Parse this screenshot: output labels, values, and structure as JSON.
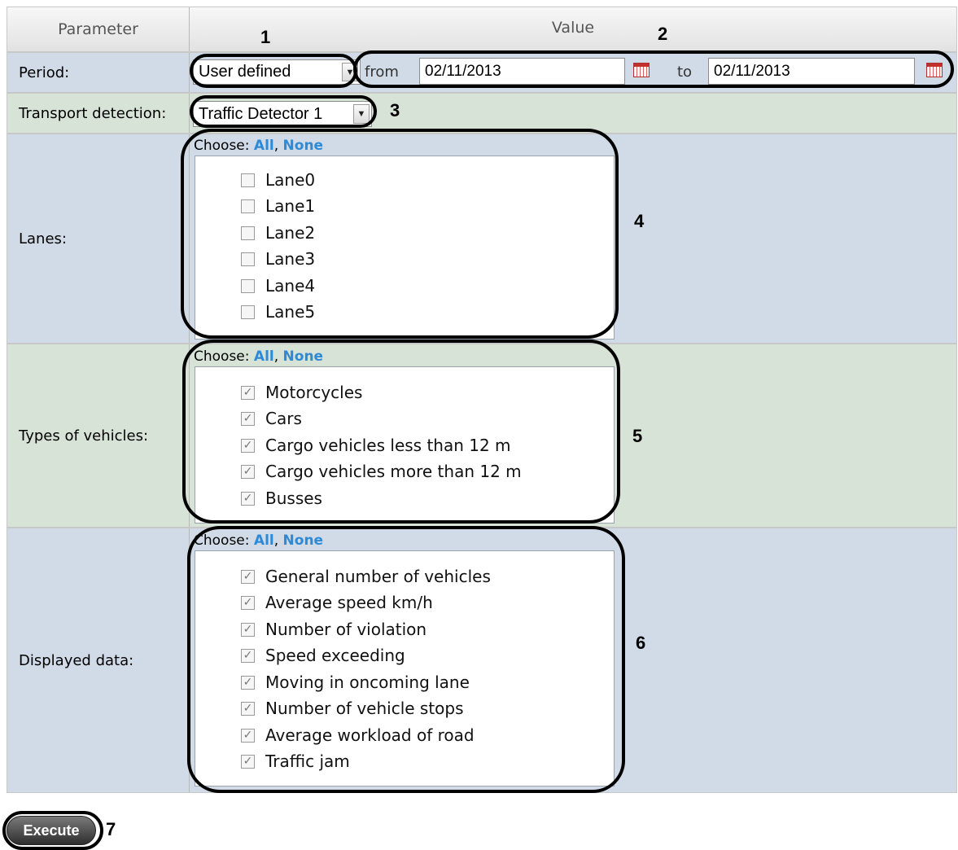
{
  "header": {
    "parameter": "Parameter",
    "value": "Value"
  },
  "period": {
    "label": "Period:",
    "selected": "User defined",
    "from_label": "from",
    "from_date": "02/11/2013",
    "to_label": "to",
    "to_date": "02/11/2013"
  },
  "transport": {
    "label": "Transport detection:",
    "selected": "Traffic Detector 1"
  },
  "lanes": {
    "label": "Lanes:",
    "choose_label": "Choose:",
    "all_label": "All",
    "none_label": "None",
    "items": [
      {
        "label": "Lane0",
        "checked": false
      },
      {
        "label": "Lane1",
        "checked": false
      },
      {
        "label": "Lane2",
        "checked": false
      },
      {
        "label": "Lane3",
        "checked": false
      },
      {
        "label": "Lane4",
        "checked": false
      },
      {
        "label": "Lane5",
        "checked": false
      }
    ]
  },
  "vehicles": {
    "label": "Types of vehicles:",
    "choose_label": "Choose:",
    "all_label": "All",
    "none_label": "None",
    "items": [
      {
        "label": "Motorcycles",
        "checked": true
      },
      {
        "label": "Cars",
        "checked": true
      },
      {
        "label": "Cargo vehicles less than 12 m",
        "checked": true
      },
      {
        "label": "Cargo vehicles more than 12 m",
        "checked": true
      },
      {
        "label": "Busses",
        "checked": true
      }
    ]
  },
  "displayed": {
    "label": "Displayed data:",
    "choose_label": "Choose:",
    "all_label": "All",
    "none_label": "None",
    "items": [
      {
        "label": "General number of vehicles",
        "checked": true
      },
      {
        "label": "Average speed km/h",
        "checked": true
      },
      {
        "label": "Number of violation",
        "checked": true
      },
      {
        "label": "Speed exceeding",
        "checked": true
      },
      {
        "label": "Moving in oncoming lane",
        "checked": true
      },
      {
        "label": "Number of vehicle stops",
        "checked": true
      },
      {
        "label": "Average workload of road",
        "checked": true
      },
      {
        "label": "Traffic jam",
        "checked": true
      }
    ]
  },
  "execute_label": "Execute",
  "markers": [
    "1",
    "2",
    "3",
    "4",
    "5",
    "6",
    "7"
  ]
}
